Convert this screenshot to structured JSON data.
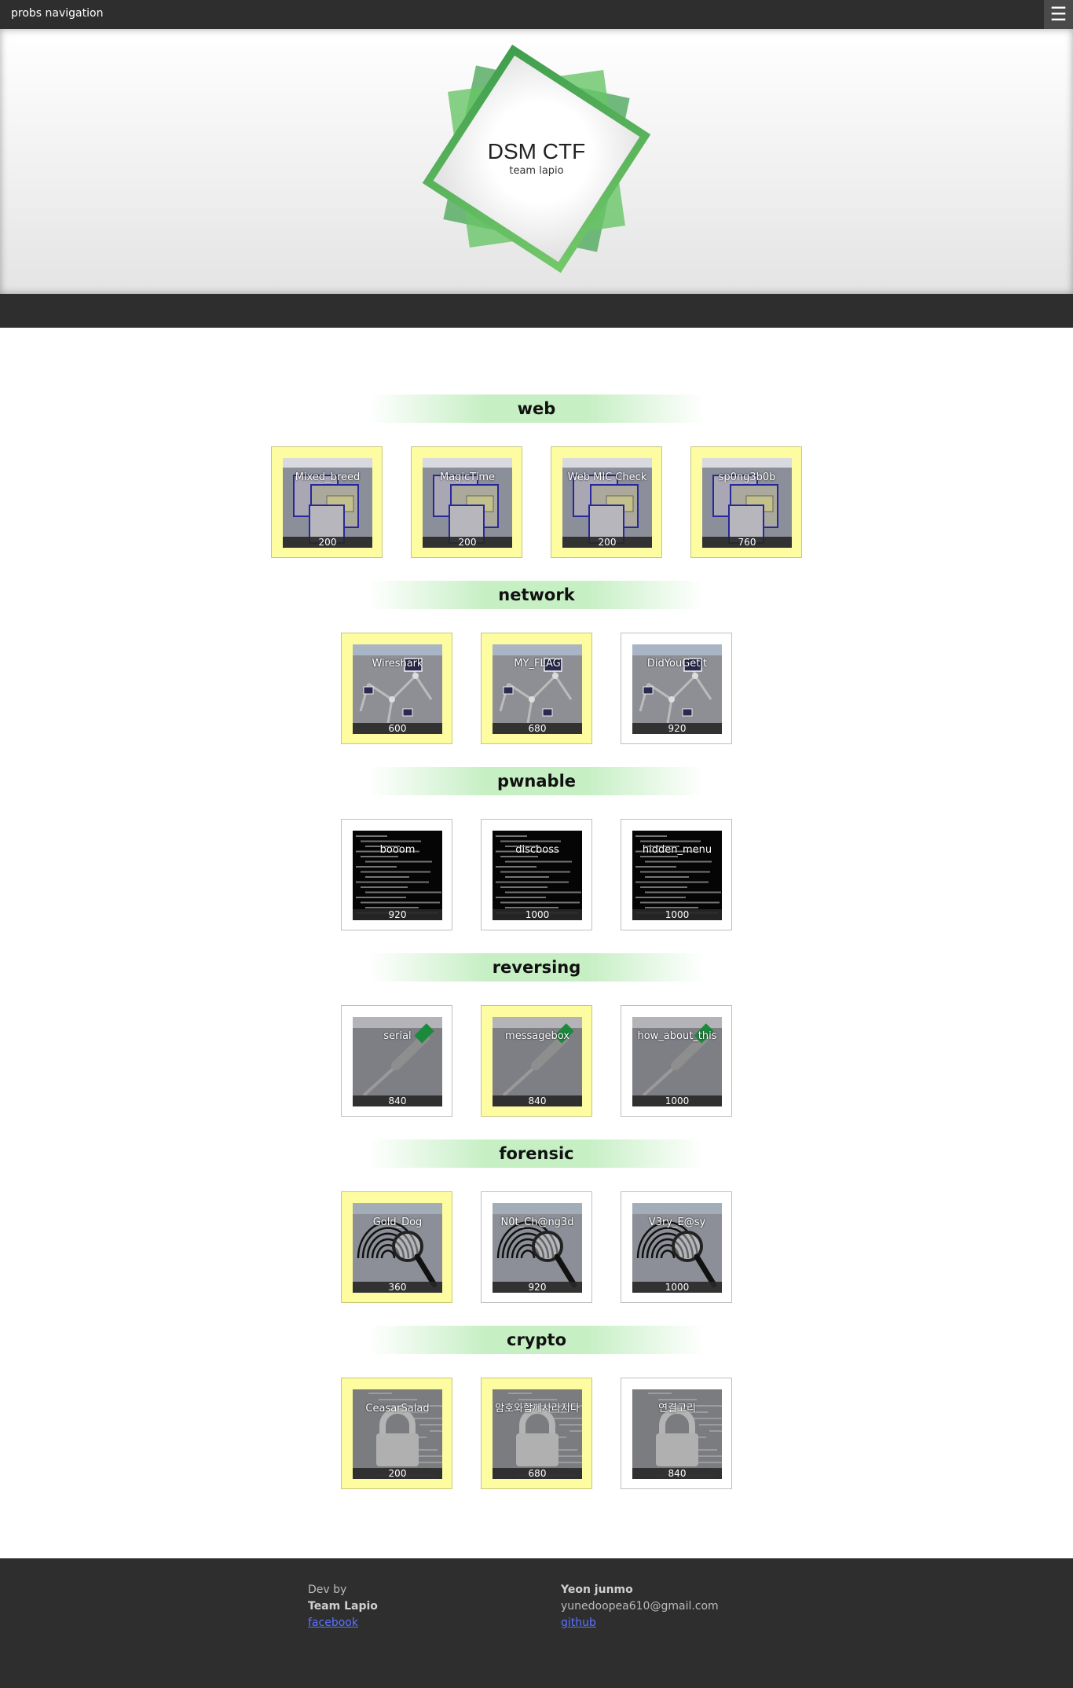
{
  "nav": {
    "title": "probs navigation",
    "menu_icon": "☰"
  },
  "hero": {
    "title": "DSM CTF",
    "subtitle": "team lapio"
  },
  "categories": [
    {
      "name": "web",
      "icon": "window-icon",
      "problems": [
        {
          "name": "Mixed_breed",
          "score": "200",
          "solved": true
        },
        {
          "name": "MagicTime",
          "score": "200",
          "solved": true
        },
        {
          "name": "Web MIC Check",
          "score": "200",
          "solved": true
        },
        {
          "name": "sp0ng3b0b",
          "score": "760",
          "solved": true
        }
      ]
    },
    {
      "name": "network",
      "icon": "network-icon",
      "problems": [
        {
          "name": "Wireshark",
          "score": "600",
          "solved": true
        },
        {
          "name": "MY_FLAG",
          "score": "680",
          "solved": true
        },
        {
          "name": "DidYouGetit",
          "score": "920",
          "solved": false
        }
      ]
    },
    {
      "name": "pwnable",
      "icon": "terminal-icon",
      "problems": [
        {
          "name": "booom",
          "score": "920",
          "solved": false
        },
        {
          "name": "discboss",
          "score": "1000",
          "solved": false
        },
        {
          "name": "hidden_menu",
          "score": "1000",
          "solved": false
        }
      ]
    },
    {
      "name": "reversing",
      "icon": "screwdriver-icon",
      "problems": [
        {
          "name": "serial",
          "score": "840",
          "solved": false
        },
        {
          "name": "messagebox",
          "score": "840",
          "solved": true
        },
        {
          "name": "how_about_this",
          "score": "1000",
          "solved": false
        }
      ]
    },
    {
      "name": "forensic",
      "icon": "fingerprint-icon",
      "problems": [
        {
          "name": "Gold_Dog",
          "score": "360",
          "solved": true
        },
        {
          "name": "N0t_Ch@ng3d",
          "score": "920",
          "solved": false
        },
        {
          "name": "V3ry_E@sy",
          "score": "1000",
          "solved": false
        }
      ]
    },
    {
      "name": "crypto",
      "icon": "lock-icon",
      "problems": [
        {
          "name": "CeasarSalad",
          "score": "200",
          "solved": true
        },
        {
          "name": "암호와함께사라지다",
          "score": "680",
          "solved": true
        },
        {
          "name": "연결고리",
          "score": "840",
          "solved": false
        }
      ]
    }
  ],
  "footer": {
    "dev_by": "Dev by",
    "team": "Team Lapio",
    "team_link": "facebook",
    "author": "Yeon junmo",
    "email": "yunedoopea610@gmail.com",
    "author_link": "github"
  }
}
